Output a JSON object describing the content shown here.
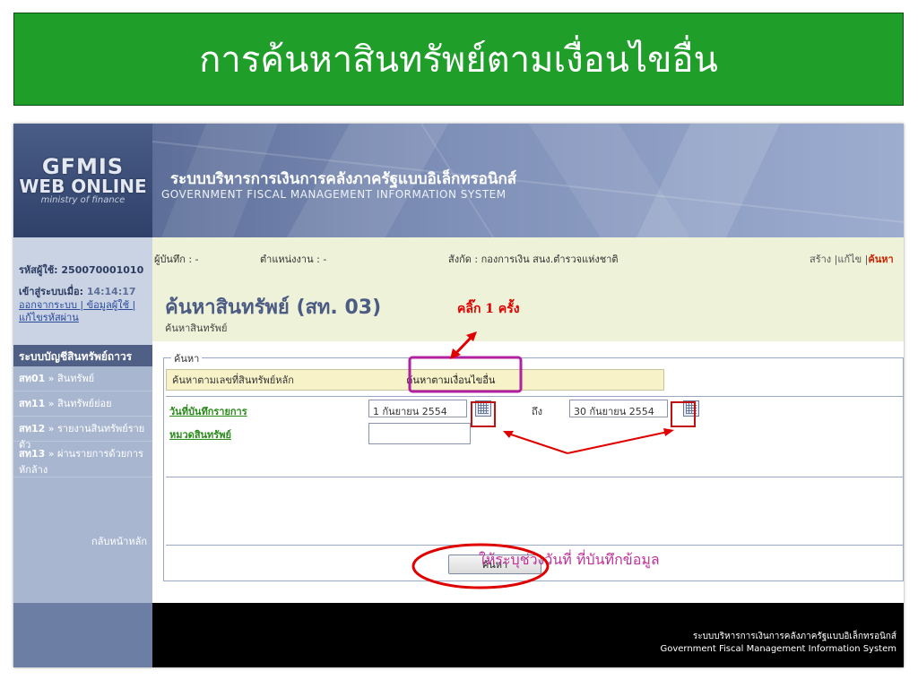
{
  "slide": {
    "title": "การค้นหาสินทรัพย์ตามเงื่อนไขอื่น"
  },
  "banner": {
    "logo_line1": "GFMIS",
    "logo_line2": "WEB ONLINE",
    "logo_line3": "ministry of finance",
    "system_th": "ระบบบริหารการเงินการคลังภาครัฐแบบอิเล็กทรอนิกส์",
    "system_en": "GOVERNMENT FISCAL MANAGEMENT INFORMATION SYSTEM"
  },
  "sidebar": {
    "user_id": "รหัสผู้ใช้: 250070001010",
    "login_label": "เข้าสู่ระบบเมื่อ:",
    "login_time": "14:14:17",
    "links": "ออกจากระบบ | ข้อมูลผู้ใช้ | แก้ไขรหัสผ่าน",
    "section": "ระบบบัญชีสินทรัพย์ถาวร",
    "items": [
      {
        "code": "สท01",
        "label": "» สินทรัพย์"
      },
      {
        "code": "สท11",
        "label": "» สินทรัพย์ย่อย"
      },
      {
        "code": "สท12",
        "label": "» รายงานสินทรัพย์รายตัว"
      },
      {
        "code": "สท13",
        "label": "» ผ่านรายการด้วยการหักล้าง"
      }
    ],
    "back": "กลับหน้าหลัก"
  },
  "topline": {
    "recorder": "ผู้บันทึก : -",
    "position": "ตำแหน่งงาน : -",
    "agency": "สังกัด : กองการเงิน สนง.ตำรวจแห่งชาติ",
    "actions": [
      "สร้าง",
      "แก้ไข",
      "ค้นหา"
    ]
  },
  "page": {
    "title": "ค้นหาสินทรัพย์ (สท. 03)",
    "subtitle": "ค้นหาสินทรัพย์"
  },
  "search": {
    "legend": "ค้นหา",
    "tab_main": "ค้นหาตามเลขที่สินทรัพย์หลัก",
    "tab_other": "ค้นหาตามเงื่อนไขอื่น",
    "date_label": "วันที่บันทึกรายการ",
    "date_from": "1 กันยายน 2554",
    "to_label": "ถึง",
    "date_to": "30 กันยายน 2554",
    "category_label": "หมวดสินทรัพย์",
    "category_value": "",
    "button": "ค้นหา"
  },
  "annotations": {
    "click_once": "คลิ๊ก 1 ครั้ง",
    "specify_date": "ให้ระบุช่วงวันที่ ที่บันทึกข้อมูล"
  },
  "footer": {
    "line1": "ระบบบริหารการเงินการคลังภาครัฐแบบอิเล็กทรอนิกส์",
    "line2": "Government Fiscal Management Information System"
  },
  "colors": {
    "title_bg": "#1f9e2a",
    "annotation_red": "#e00000",
    "annotation_magenta": "#c0309a",
    "highlight_box": "#b020a0"
  }
}
